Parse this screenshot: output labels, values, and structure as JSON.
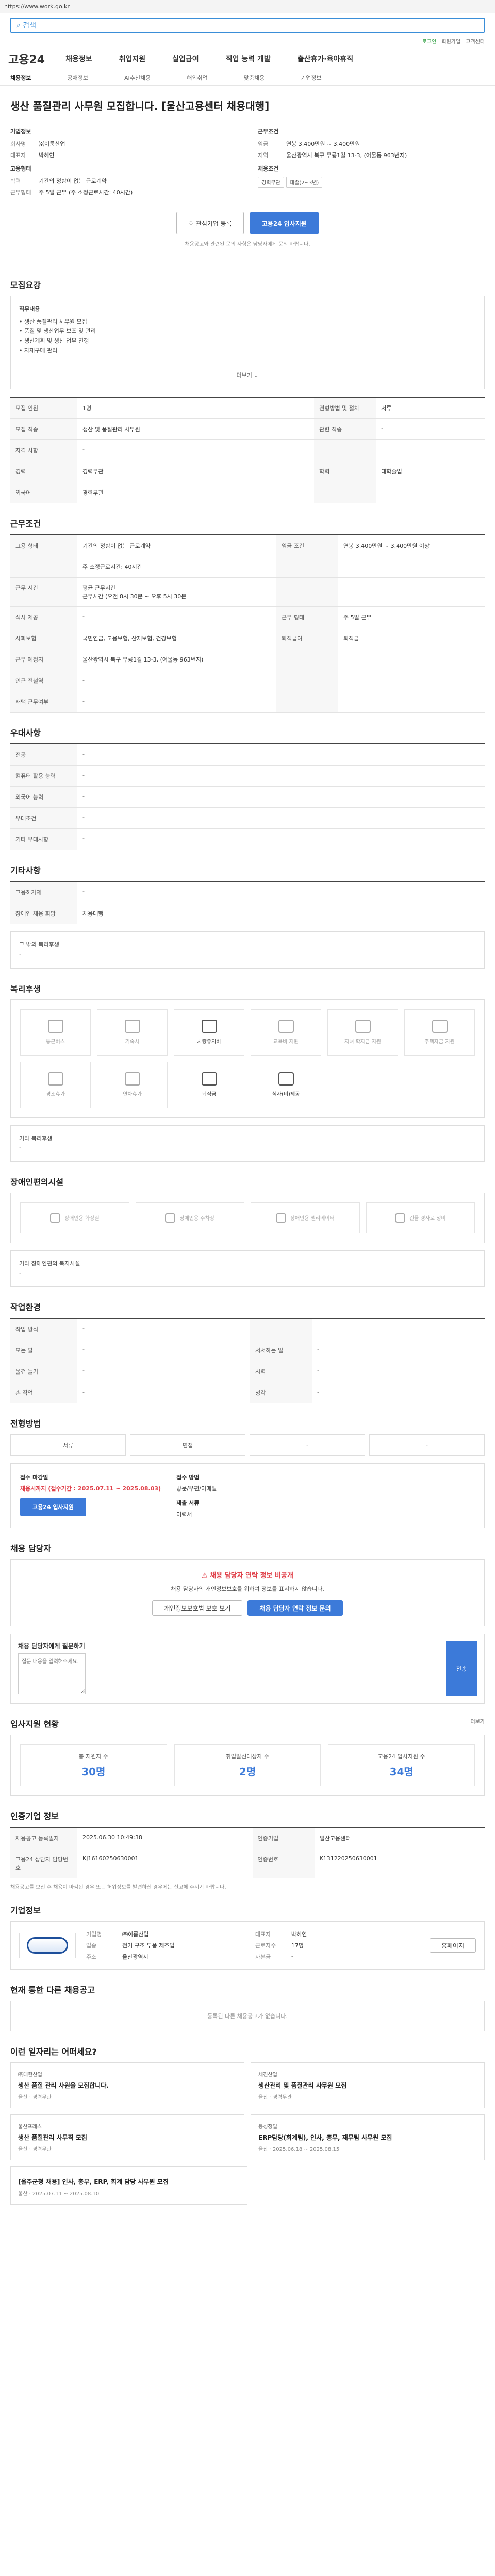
{
  "top": {
    "address": "https://www.work.go.kr",
    "search_placeholder": "검색",
    "links": [
      "로그인",
      "회원가입",
      "고객센터"
    ]
  },
  "header": {
    "logo": "고용24",
    "nav": [
      "채용정보",
      "취업지원",
      "실업급여",
      "직업 능력 개발",
      "출산휴가·육아휴직"
    ]
  },
  "subnav": [
    "채용정보",
    "공채정보",
    "AI추천채용",
    "해외취업",
    "맞춤채용",
    "기업정보"
  ],
  "job": {
    "title": "생산 품질관리 사무원 모집합니다. [울산고용센터 채용대행]",
    "company_label": "기업정보",
    "company": {
      "name_k": "회사명",
      "name_v": "㈜이룸산업",
      "rep_k": "대표자",
      "rep_v": "박혜연"
    },
    "cond_label": "근무조건",
    "cond": {
      "pay_k": "임금",
      "pay_v": "연봉 3,400만원 ~ 3,400만원",
      "addr_k": "지역",
      "addr_v": "울산광역시 북구 무룡1길 13-3, (어물동 963번지)"
    },
    "req_label": "고용형태",
    "req": {
      "edu_k": "학력",
      "edu_v": "기간의 정함이 없는 근로계약",
      "career_k": "근무형태",
      "career_v": "주 5일 근무 (주 소정근로시간: 40시간)"
    },
    "tags_label": "채용조건",
    "tags": [
      "경력무관",
      "대졸(2~3년)"
    ],
    "btn_interest": "관심기업 등록",
    "btn_apply": "고용24 입사지원",
    "notice": "채용공고와 관련된 문의 사항은 담당자에게 문의 바랍니다."
  },
  "section_recruit": {
    "title": "모집요강",
    "duties_label": "직무내용",
    "duties": [
      "• 생산 품질관리 사무원 모집",
      "• 품질 및 생산업무 보조 및 관리",
      "• 생산계획 및 생산 업무 진행",
      "• 자재구매 관리"
    ],
    "more": "더보기",
    "rows": [
      {
        "k": "모집 인원",
        "v": "1명",
        "k2": "전형방법 및 절차",
        "v2": "서류"
      },
      {
        "k": "모집 직종",
        "v": "생산 및 품질관리 사무원",
        "k2": "관련 직종",
        "v2": "-"
      },
      {
        "k": "자격 사항",
        "v": "-",
        "k2": "",
        "v2": ""
      },
      {
        "k": "경력",
        "v": "경력무관",
        "k2": "학력",
        "v2": "대학졸업"
      },
      {
        "k": "외국어",
        "v": "경력무관",
        "k2": "",
        "v2": ""
      }
    ]
  },
  "section_cond": {
    "title": "근무조건",
    "rows": [
      {
        "k": "고용 형태",
        "v": "기간의 정함이 없는 근로계약",
        "k2": "임금 조건",
        "v2": "연봉 3,400만원 ~ 3,400만원 이상"
      },
      {
        "k": "",
        "v": "주 소정근로시간: 40시간",
        "k2": "",
        "v2": ""
      },
      {
        "k": "근무 시간",
        "v": "평균 근무시간\n근무시간 (오전 8시 30분 ~ 오후 5시 30분",
        "k2": "",
        "v2": ""
      },
      {
        "k": "식사 제공",
        "v": "-",
        "k2": "근무 형태",
        "v2": "주 5일 근무"
      },
      {
        "k": "사회보험",
        "v": "국민연금, 고용보험, 산재보험, 건강보험",
        "k2": "퇴직급여",
        "v2": "퇴직금"
      },
      {
        "k": "근무 예정지",
        "v": "울산광역시 북구 무룡1길 13-3, (어물동 963번지)",
        "k2": "",
        "v2": ""
      },
      {
        "k": "인근 전철역",
        "v": "-",
        "k2": "",
        "v2": ""
      },
      {
        "k": "재택 근무여부",
        "v": "-",
        "k2": "",
        "v2": ""
      }
    ]
  },
  "section_pref": {
    "title": "우대사항",
    "rows": [
      {
        "k": "전공",
        "v": "-"
      },
      {
        "k": "컴퓨터 활용 능력",
        "v": "-"
      },
      {
        "k": "외국어 능력",
        "v": "-"
      },
      {
        "k": "우대조건",
        "v": "-"
      },
      {
        "k": "기타 우대사항",
        "v": "-"
      }
    ]
  },
  "section_etc": {
    "title": "기타사항",
    "rows": [
      {
        "k": "고용허가제",
        "v": "-"
      },
      {
        "k": "장애인 채용 희망",
        "v": "채용대행"
      }
    ],
    "extra": "그 밖의 복리후생",
    "extra_v": "-"
  },
  "section_welfare": {
    "title": "복리후생",
    "items": [
      {
        "label": "통근버스",
        "on": false
      },
      {
        "label": "기숙사",
        "on": false
      },
      {
        "label": "차량유지비",
        "on": true
      },
      {
        "label": "교육비 지원",
        "on": false
      },
      {
        "label": "자녀 학자금 지원",
        "on": false
      },
      {
        "label": "주택자금 지원",
        "on": false
      },
      {
        "label": "경조휴가",
        "on": false
      },
      {
        "label": "연차휴가",
        "on": false
      },
      {
        "label": "퇴직금",
        "on": true
      },
      {
        "label": "식사(비)제공",
        "on": true
      }
    ],
    "other": "기타 복리후생",
    "other_v": "-"
  },
  "section_disab": {
    "title": "장애인편의시설",
    "items": [
      "장애인용 화장실",
      "장애인용 주차장",
      "장애인용 엘리베이터",
      "건물 경사로 정비"
    ],
    "other": "기타 장애인편의 복지시설",
    "other_v": "-"
  },
  "section_env": {
    "title": "작업환경",
    "rows": [
      {
        "k": "작업 방식",
        "v": "-",
        "k2": "",
        "v2": ""
      },
      {
        "k": "모는 팔",
        "v": "-",
        "k2": "서서하는 일",
        "v2": "-"
      },
      {
        "k": "물건 들기",
        "v": "-",
        "k2": "시력",
        "v2": "-"
      },
      {
        "k": "손 작업",
        "v": "-",
        "k2": "청각",
        "v2": "-"
      }
    ]
  },
  "section_process": {
    "title": "전형방법",
    "steps": [
      "서류",
      "면접",
      "-",
      "-"
    ]
  },
  "section_apply": {
    "period_k": "접수 마감일",
    "period_v": "채용시까지 (접수기간 : 2025.07.11 ~ 2025.08.03)",
    "method_k": "접수 방법",
    "method_v": "방문/우편/이메일",
    "btn": "고용24 입사지원",
    "doc_k": "제출 서류",
    "doc_v": "이력서"
  },
  "section_contact": {
    "title": "채용 담당자",
    "alert": "채용 담당자 연락 정보 비공개",
    "desc": "채용 담당자의 개인정보보호를 위하여 정보를 표시하지 않습니다.",
    "btn1": "개인정보보호법 보호 보기",
    "btn2": "채용 담당자 연락 정보 문의"
  },
  "section_qa": {
    "title": "채용 담당자에게 질문하기",
    "placeholder": "질문 내용을 입력해주세요.",
    "send": "전송"
  },
  "section_stats": {
    "title": "입사지원 현황",
    "link": "더보기",
    "items": [
      {
        "label": "총 지원자 수",
        "v": "30명"
      },
      {
        "label": "취업알선대상자 수",
        "v": "2명"
      },
      {
        "label": "고용24 입사지원 수",
        "v": "34명"
      }
    ]
  },
  "section_info": {
    "title": "인증기업 정보",
    "rows": [
      {
        "k": "채용공고 등록일자",
        "v": "2025.06.30 10:49:38",
        "k2": "인증기업",
        "v2": "일산고용센터"
      },
      {
        "k": "고용24 상담자 담당번호",
        "v": "KJ16160250630001",
        "k2": "인증번호",
        "v2": "K131220250630001"
      }
    ],
    "note": "채용공고를 보신 후 채용이 마감된 경우 또는 허위정보를 발견하신 경우에는 신고해 주시기 바랍니다."
  },
  "section_company": {
    "title": "기업정보",
    "rows": [
      {
        "k": "기업명",
        "v": "㈜이룸산업",
        "k2": "대표자",
        "v2": "박혜연"
      },
      {
        "k": "업종",
        "v": "전기 구조 부품 제조업",
        "k2": "근로자수",
        "v2": "17명"
      },
      {
        "k": "주소",
        "v": "울산광역시",
        "k2": "자본금",
        "v2": "-"
      }
    ],
    "btn": "홈페이지"
  },
  "section_similar": {
    "title": "현재 통한 다른 채용공고",
    "empty": "등록된 다른 채용공고가 없습니다."
  },
  "section_recommend": {
    "title": "이런 일자리는 어떠세요?",
    "items": [
      {
        "co": "㈜대한산업",
        "t": "생산 품질 관리 사원을 모집합니다.",
        "m": "울산 · 경력무관"
      },
      {
        "co": "세진산업",
        "t": "생산관리 및 품질관리 사무원 모집",
        "m": "울산 · 경력무관"
      },
      {
        "co": "울산프레스",
        "t": "생산 품질관리 사무직 모집",
        "m": "울산 · 경력무관"
      },
      {
        "co": "동성정밀",
        "t": "ERP담당(회계팀), 인사, 총무, 재무팀 사무원 모집",
        "m": "울산 · 2025.06.18 ~ 2025.08.15"
      },
      {
        "co": "",
        "t": "[울주군청 채용] 인사, 총무, ERP, 회계 담당 사무원 모집",
        "m": "울산 · 2025.07.11 ~ 2025.08.10"
      }
    ]
  }
}
